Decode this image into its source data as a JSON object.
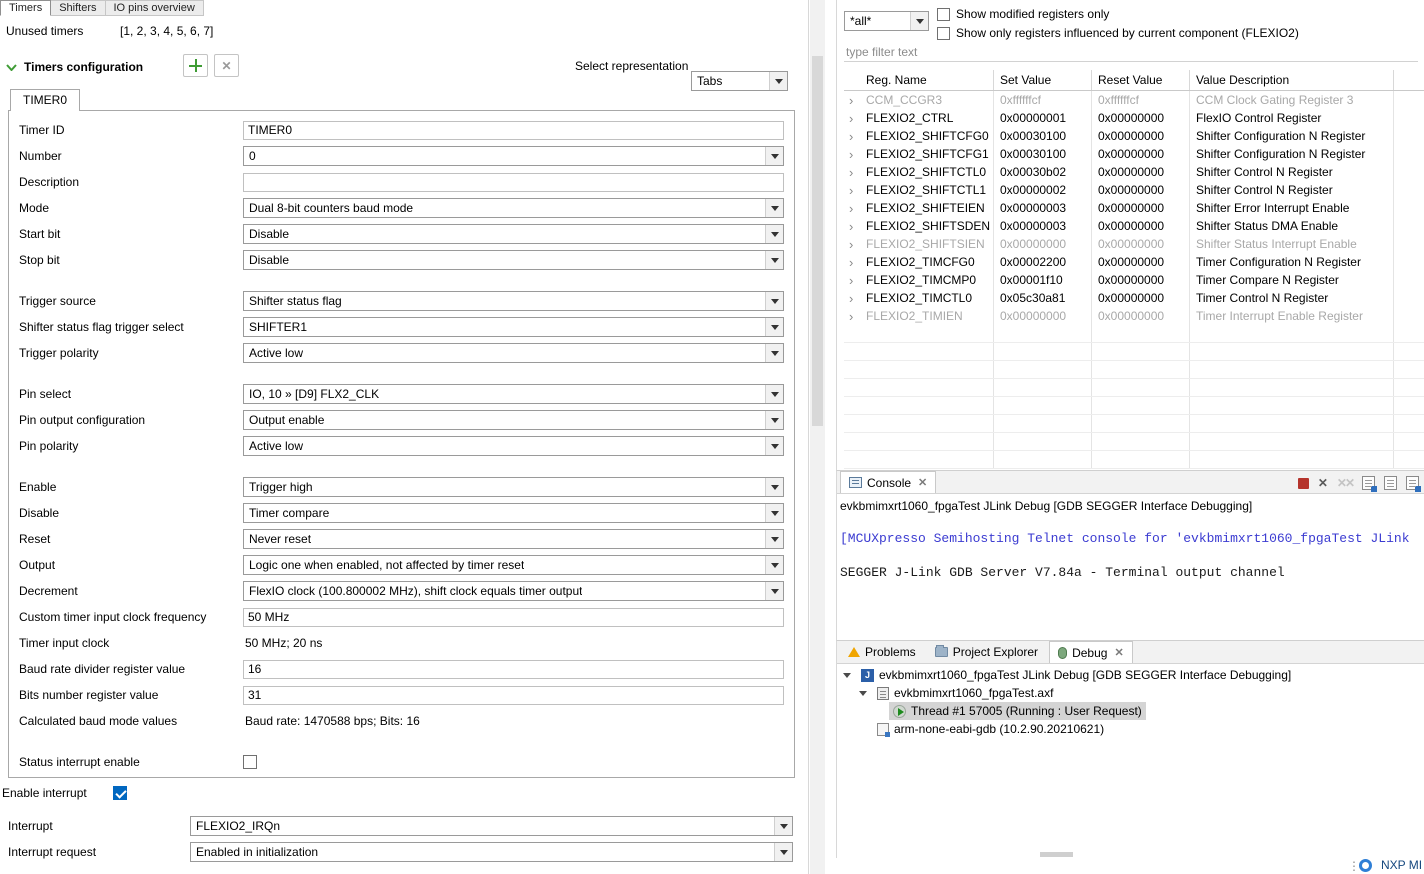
{
  "editor": {
    "tabs": [
      {
        "label": "Timers",
        "active": true
      },
      {
        "label": "Shifters",
        "active": false
      },
      {
        "label": "IO pins overview",
        "active": false
      }
    ],
    "unused_timers": {
      "label": "Unused timers",
      "value": "[1, 2, 3, 4, 5, 6, 7]"
    },
    "section": {
      "title": "Timers configuration"
    },
    "representation": {
      "label": "Select representation",
      "value": "Tabs"
    },
    "timer_tabs": [
      {
        "label": "TIMER0",
        "active": true
      }
    ],
    "form_groups": [
      {
        "rows": [
          {
            "label": "Timer ID",
            "type": "text",
            "value": "TIMER0"
          },
          {
            "label": "Number",
            "type": "select",
            "value": "0"
          },
          {
            "label": "Description",
            "type": "text",
            "value": ""
          },
          {
            "label": "Mode",
            "type": "select",
            "value": "Dual 8-bit counters baud mode"
          },
          {
            "label": "Start bit",
            "type": "select",
            "value": "Disable"
          },
          {
            "label": "Stop bit",
            "type": "select",
            "value": "Disable"
          }
        ]
      },
      {
        "rows": [
          {
            "label": "Trigger source",
            "type": "select",
            "value": "Shifter status flag"
          },
          {
            "label": "Shifter status flag trigger select",
            "type": "select",
            "value": "SHIFTER1"
          },
          {
            "label": "Trigger polarity",
            "type": "select",
            "value": "Active low"
          }
        ]
      },
      {
        "rows": [
          {
            "label": "Pin select",
            "type": "select",
            "value": "IO, 10 » [D9] FLX2_CLK"
          },
          {
            "label": "Pin output configuration",
            "type": "select",
            "value": "Output enable"
          },
          {
            "label": "Pin polarity",
            "type": "select",
            "value": "Active low"
          }
        ]
      },
      {
        "rows": [
          {
            "label": "Enable",
            "type": "select",
            "value": "Trigger high"
          },
          {
            "label": "Disable",
            "type": "select",
            "value": "Timer compare"
          },
          {
            "label": "Reset",
            "type": "select",
            "value": "Never reset"
          },
          {
            "label": "Output",
            "type": "select",
            "value": "Logic one when enabled, not affected by timer reset"
          },
          {
            "label": "Decrement",
            "type": "select",
            "value": "FlexIO clock (100.800002 MHz), shift clock equals timer output"
          },
          {
            "label": "Custom timer input clock frequency",
            "type": "text",
            "value": "50 MHz"
          },
          {
            "label": "Timer input clock",
            "type": "static",
            "value": "50 MHz; 20 ns"
          },
          {
            "label": "Baud rate divider register value",
            "type": "text",
            "value": "16"
          },
          {
            "label": "Bits number register value",
            "type": "text",
            "value": "31"
          },
          {
            "label": "Calculated baud mode values",
            "type": "static",
            "value": "Baud rate: 1470588 bps; Bits: 16"
          }
        ]
      },
      {
        "rows": [
          {
            "label": "Status interrupt enable",
            "type": "checkbox",
            "checked": false
          }
        ]
      }
    ],
    "interrupt": {
      "enable_label": "Enable interrupt",
      "enable_checked": true,
      "rows": [
        {
          "label": "Interrupt",
          "type": "select",
          "value": "FLEXIO2_IRQn"
        },
        {
          "label": "Interrupt request",
          "type": "select",
          "value": "Enabled in initialization"
        }
      ]
    }
  },
  "registers": {
    "filter_combo": "*all*",
    "show_modified_label": "Show modified registers only",
    "show_influenced_label": "Show only registers influenced by current component (FLEXIO2)",
    "filter_placeholder": "type filter text",
    "columns": [
      "Reg. Name",
      "Set Value",
      "Reset Value",
      "Value Description"
    ],
    "rows": [
      {
        "name": "CCM_CCGR3",
        "set": "0xffffffcf",
        "reset": "0xffffffcf",
        "desc": "CCM Clock Gating Register 3",
        "dim": true
      },
      {
        "name": "FLEXIO2_CTRL",
        "set": "0x00000001",
        "reset": "0x00000000",
        "desc": "FlexIO Control Register",
        "dim": false
      },
      {
        "name": "FLEXIO2_SHIFTCFG0",
        "set": "0x00030100",
        "reset": "0x00000000",
        "desc": "Shifter Configuration N Register",
        "dim": false
      },
      {
        "name": "FLEXIO2_SHIFTCFG1",
        "set": "0x00030100",
        "reset": "0x00000000",
        "desc": "Shifter Configuration N Register",
        "dim": false
      },
      {
        "name": "FLEXIO2_SHIFTCTL0",
        "set": "0x00030b02",
        "reset": "0x00000000",
        "desc": "Shifter Control N Register",
        "dim": false
      },
      {
        "name": "FLEXIO2_SHIFTCTL1",
        "set": "0x00000002",
        "reset": "0x00000000",
        "desc": "Shifter Control N Register",
        "dim": false
      },
      {
        "name": "FLEXIO2_SHIFTEIEN",
        "set": "0x00000003",
        "reset": "0x00000000",
        "desc": "Shifter Error Interrupt Enable",
        "dim": false
      },
      {
        "name": "FLEXIO2_SHIFTSDEN",
        "set": "0x00000003",
        "reset": "0x00000000",
        "desc": "Shifter Status DMA Enable",
        "dim": false
      },
      {
        "name": "FLEXIO2_SHIFTSIEN",
        "set": "0x00000000",
        "reset": "0x00000000",
        "desc": "Shifter Status Interrupt Enable",
        "dim": true
      },
      {
        "name": "FLEXIO2_TIMCFG0",
        "set": "0x00002200",
        "reset": "0x00000000",
        "desc": "Timer Configuration N Register",
        "dim": false
      },
      {
        "name": "FLEXIO2_TIMCMP0",
        "set": "0x00001f10",
        "reset": "0x00000000",
        "desc": "Timer Compare N Register",
        "dim": false
      },
      {
        "name": "FLEXIO2_TIMCTL0",
        "set": "0x05c30a81",
        "reset": "0x00000000",
        "desc": "Timer Control N Register",
        "dim": false
      },
      {
        "name": "FLEXIO2_TIMIEN",
        "set": "0x00000000",
        "reset": "0x00000000",
        "desc": "Timer Interrupt Enable Register",
        "dim": true
      }
    ],
    "empty_row_count": 8
  },
  "console": {
    "tab": "Console",
    "title": "evkbmimxrt1060_fpgaTest JLink Debug [GDB SEGGER Interface Debugging]",
    "lines": [
      {
        "text": "[MCUXpresso Semihosting Telnet console for 'evkbmimxrt1060_fpgaTest JLink",
        "color": "blue"
      },
      {
        "text": "SEGGER J-Link GDB Server V7.84a - Terminal output channel",
        "color": "black"
      }
    ]
  },
  "bottom": {
    "tabs": [
      {
        "label": "Problems",
        "active": false,
        "icon": "problems",
        "closable": false
      },
      {
        "label": "Project Explorer",
        "active": false,
        "icon": "project-explorer",
        "closable": false
      },
      {
        "label": "Debug",
        "active": true,
        "icon": "debug",
        "closable": true
      }
    ],
    "tree": [
      {
        "indent": 0,
        "expander": true,
        "icon": "jlink-launch",
        "text": "evkbmimxrt1060_fpgaTest JLink Debug [GDB SEGGER Interface Debugging]",
        "selected": false
      },
      {
        "indent": 1,
        "expander": true,
        "icon": "axf-binary",
        "text": "evkbmimxrt1060_fpgaTest.axf",
        "selected": false
      },
      {
        "indent": 2,
        "expander": false,
        "icon": "thread-running",
        "text": "Thread #1 57005 (Running : User Request)",
        "selected": true
      },
      {
        "indent": 1,
        "expander": false,
        "icon": "gdb-process",
        "text": "arm-none-eabi-gdb (10.2.90.20210621)",
        "selected": false
      }
    ]
  },
  "statusbar": {
    "nxp_label": "NXP MI",
    "overflow_glyph": "⋮"
  }
}
